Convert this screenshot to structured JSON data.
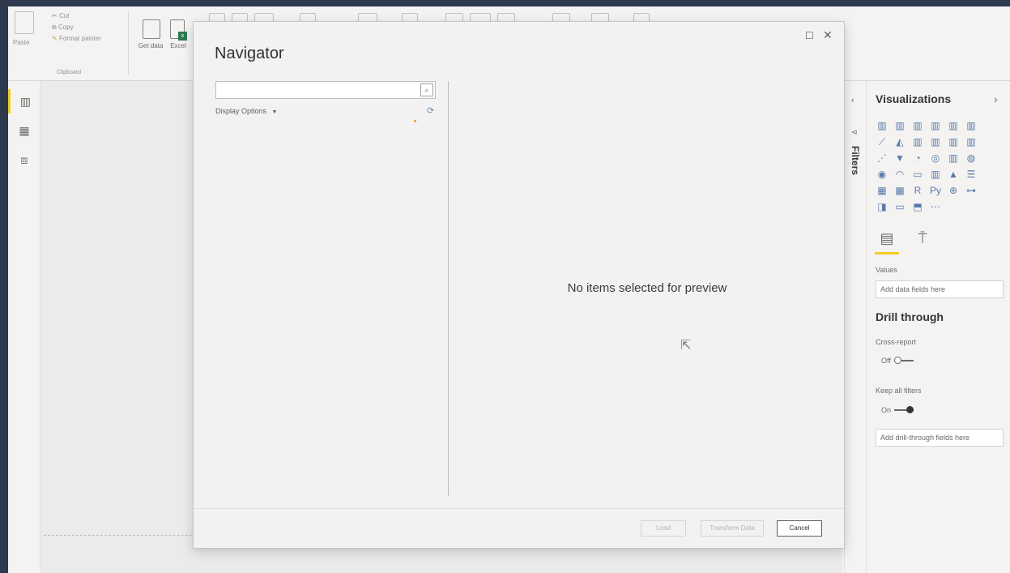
{
  "ribbon": {
    "clipboard": {
      "paste_label": "Paste",
      "cut_label": "Cut",
      "copy_label": "Copy",
      "format_painter_label": "Format painter",
      "group_label": "Clipboard"
    },
    "get_data_label": "Get data",
    "excel_label": "Excel"
  },
  "navigator": {
    "title": "Navigator",
    "search_value": "",
    "display_options_label": "Display Options",
    "preview_message": "No items selected for preview",
    "buttons": {
      "load": "Load",
      "transform": "Transform Data",
      "cancel": "Cancel"
    }
  },
  "filters": {
    "label": "Filters"
  },
  "visualizations": {
    "title": "Visualizations",
    "values_label": "Values",
    "values_well": "Add data fields here",
    "drill_title": "Drill through",
    "cross_report_label": "Cross-report",
    "cross_report_state": "Off",
    "keep_filters_label": "Keep all filters",
    "keep_filters_state": "On",
    "drill_well": "Add drill-through fields here",
    "icons": [
      "stacked-bar-icon",
      "stacked-column-icon",
      "clustered-bar-icon",
      "clustered-column-icon",
      "100-bar-icon",
      "100-column-icon",
      "line-chart-icon",
      "area-chart-icon",
      "stacked-area-icon",
      "ribbon-chart-icon",
      "waterfall-icon",
      "line-column-icon",
      "scatter-icon",
      "funnel-icon",
      "pie-icon",
      "donut-icon",
      "treemap-icon",
      "map-icon",
      "filled-map-icon",
      "gauge-icon",
      "card-icon",
      "multirow-card-icon",
      "kpi-icon",
      "slicer-icon",
      "table-icon",
      "matrix-icon",
      "r-visual-icon",
      "python-visual-icon",
      "key-influencers-icon",
      "decomposition-tree-icon",
      "qa-icon",
      "smart-narrative-icon",
      "paginated-icon",
      "more-visuals-icon"
    ]
  },
  "colors": {
    "accent_yellow": "#f2c811",
    "text_dark": "#252423",
    "dialog_bg": "#f2f2f2"
  }
}
